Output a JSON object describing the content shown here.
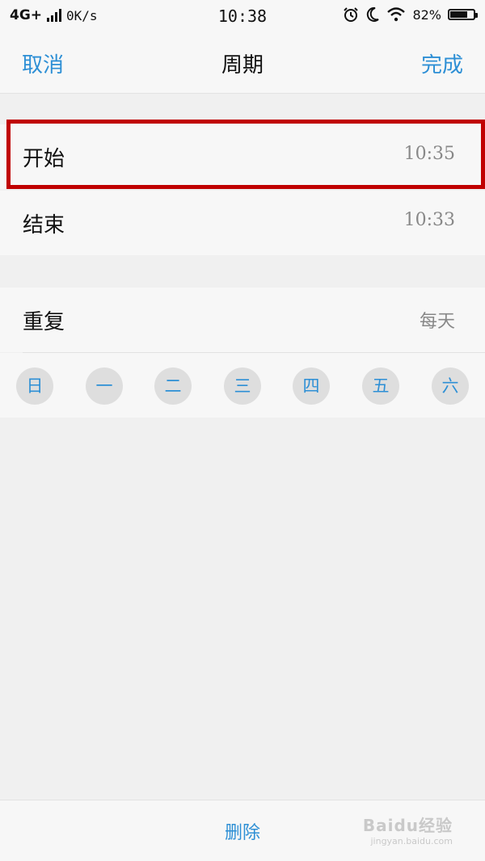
{
  "status_bar": {
    "network": "4G+",
    "speed": "0K/s",
    "time": "10:38",
    "battery_percent_text": "82%",
    "battery_level": 0.82,
    "icons": [
      "signal-icon",
      "alarm-icon",
      "moon-icon",
      "wifi-icon",
      "battery-icon"
    ]
  },
  "nav": {
    "cancel": "取消",
    "title": "周期",
    "done": "完成"
  },
  "rows": {
    "start": {
      "label": "开始",
      "value": "10:35"
    },
    "end": {
      "label": "结束",
      "value": "10:33"
    },
    "repeat": {
      "label": "重复",
      "value": "每天"
    }
  },
  "weekdays": [
    "日",
    "一",
    "二",
    "三",
    "四",
    "五",
    "六"
  ],
  "bottom": {
    "delete": "删除"
  },
  "watermark": {
    "logo": "Baidu经验",
    "url": "jingyan.baidu.com"
  },
  "colors": {
    "accent": "#2d8fd5",
    "highlight": "#c00000",
    "background": "#f0f0f0",
    "cell": "#f7f7f7"
  }
}
